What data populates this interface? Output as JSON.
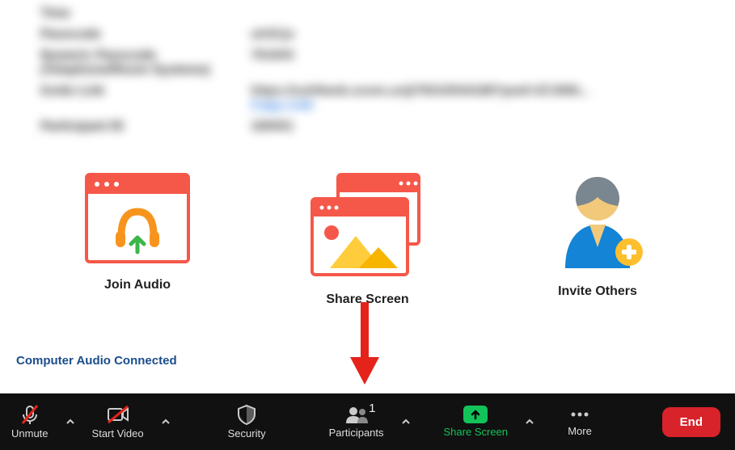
{
  "info": {
    "rows": [
      {
        "label": "Time",
        "value": ""
      },
      {
        "label": "Passcode",
        "value": "uh3Cjn"
      },
      {
        "label": "Numeric Passcode (Telephone/Room Systems)",
        "value": "761843"
      },
      {
        "label": "Invite Link",
        "value": "https://us04web.zoom.us/j/78310544188?pwd=ZC3NN...",
        "extra": "Copy Link"
      },
      {
        "label": "Participant ID",
        "value": "180001"
      }
    ]
  },
  "cards": {
    "join_audio": "Join Audio",
    "share_screen": "Share Screen",
    "invite_others": "Invite Others"
  },
  "audio_status": "Computer Audio Connected",
  "toolbar": {
    "unmute": "Unmute",
    "start_video": "Start Video",
    "security": "Security",
    "participants": "Participants",
    "participants_count": "1",
    "share_screen": "Share Screen",
    "more": "More",
    "end": "End"
  }
}
